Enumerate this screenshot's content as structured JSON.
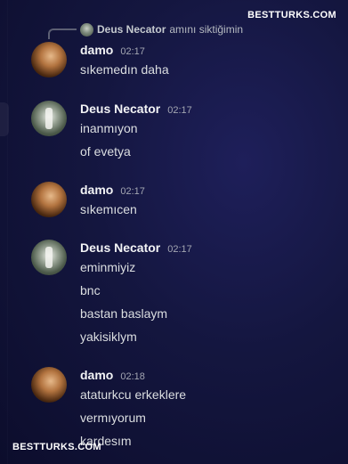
{
  "watermark": "BESTTURKS.COM",
  "reply": {
    "author": "Deus Necator",
    "text": "amını siktiğimin"
  },
  "messages": [
    {
      "author": "damo",
      "time": "02:17",
      "avatar": "damo-avatar",
      "lines": [
        "sıkemedın daha"
      ]
    },
    {
      "author": "Deus Necator",
      "time": "02:17",
      "avatar": "deus-necator-avatar",
      "lines": [
        "inanmıyon",
        "of evetya"
      ]
    },
    {
      "author": "damo",
      "time": "02:17",
      "avatar": "damo-avatar",
      "lines": [
        "sıkemıcen"
      ]
    },
    {
      "author": "Deus Necator",
      "time": "02:17",
      "avatar": "deus-necator-avatar",
      "lines": [
        "eminmiyiz",
        "bnc",
        "bastan baslaym",
        "yakisiklym"
      ]
    },
    {
      "author": "damo",
      "time": "02:18",
      "avatar": "damo-avatar",
      "lines": [
        "ataturkcu erkeklere",
        "vermıyorum",
        "kardesım"
      ]
    }
  ]
}
